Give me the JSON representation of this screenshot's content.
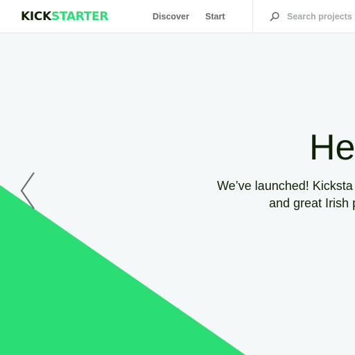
{
  "header": {
    "logo": {
      "part1": "KICK",
      "part2": "STARTER"
    },
    "nav": {
      "discover": "Discover",
      "start": "Start"
    },
    "search": {
      "placeholder": "Search projects",
      "icon": "search-icon"
    }
  },
  "hero": {
    "title": "He",
    "line1": "We’ve launched! Kicksta",
    "line2": "and great Irish p",
    "prev_icon": "chevron-left-icon"
  },
  "colors": {
    "brand_green": "#2bde73",
    "brand_dark": "#0f2105",
    "background": "#f4f8f9",
    "nav_text": "#656969"
  }
}
